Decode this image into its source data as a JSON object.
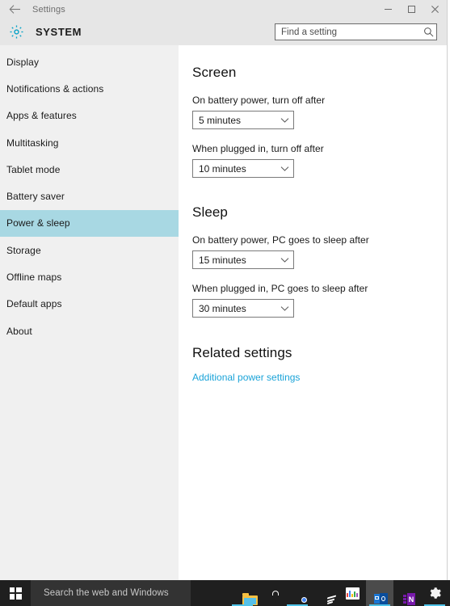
{
  "window": {
    "titlebar": {
      "back_icon": "back-arrow-icon",
      "title": "Settings",
      "minimize_label": "Minimize",
      "maximize_label": "Maximize",
      "close_label": "Close"
    },
    "header": {
      "gear_icon": "gear-icon",
      "category_title": "SYSTEM",
      "search": {
        "placeholder": "Find a setting",
        "value": "",
        "icon": "search-icon"
      }
    }
  },
  "sidebar": {
    "selected": "Power & sleep",
    "items": [
      {
        "label": "Display",
        "selected": false
      },
      {
        "label": "Notifications & actions",
        "selected": false
      },
      {
        "label": "Apps & features",
        "selected": false
      },
      {
        "label": "Multitasking",
        "selected": false
      },
      {
        "label": "Tablet mode",
        "selected": false
      },
      {
        "label": "Battery saver",
        "selected": false
      },
      {
        "label": "Power & sleep",
        "selected": true
      },
      {
        "label": "Storage",
        "selected": false
      },
      {
        "label": "Offline maps",
        "selected": false
      },
      {
        "label": "Default apps",
        "selected": false
      },
      {
        "label": "About",
        "selected": false
      }
    ]
  },
  "main": {
    "screen": {
      "heading": "Screen",
      "battery": {
        "label": "On battery power, turn off after",
        "value": "5 minutes"
      },
      "plugged": {
        "label": "When plugged in, turn off after",
        "value": "10 minutes"
      }
    },
    "sleep": {
      "heading": "Sleep",
      "battery": {
        "label": "On battery power, PC goes to sleep after",
        "value": "15 minutes"
      },
      "plugged": {
        "label": "When plugged in, PC goes to sleep after",
        "value": "30 minutes"
      }
    },
    "related": {
      "heading": "Related settings",
      "link_label": "Additional power settings"
    }
  },
  "taskbar": {
    "start_label": "Start",
    "search_placeholder": "Search the web and Windows",
    "apps": [
      {
        "name": "file-explorer",
        "label": "File Explorer",
        "running": true,
        "active": false
      },
      {
        "name": "store",
        "label": "Store",
        "running": false,
        "active": false
      },
      {
        "name": "chrome",
        "label": "Google Chrome",
        "running": true,
        "active": false
      },
      {
        "name": "todoist",
        "label": "Todoist",
        "running": false,
        "active": false
      },
      {
        "name": "app-tile",
        "label": "App",
        "running": false,
        "active": false
      },
      {
        "name": "outlook",
        "label": "Outlook",
        "running": true,
        "active": true
      },
      {
        "name": "onenote",
        "label": "OneNote",
        "running": false,
        "active": false
      },
      {
        "name": "settings",
        "label": "Settings",
        "running": true,
        "active": false
      }
    ]
  },
  "colors": {
    "accent_selected": "#a8d8e3",
    "link": "#1aa3d8",
    "gear_accent": "#00a2c7",
    "sidebar_bg": "#f0f0f0",
    "chrome_bg": "#e6e6e6",
    "taskbar_bg": "#1f1f1f"
  }
}
